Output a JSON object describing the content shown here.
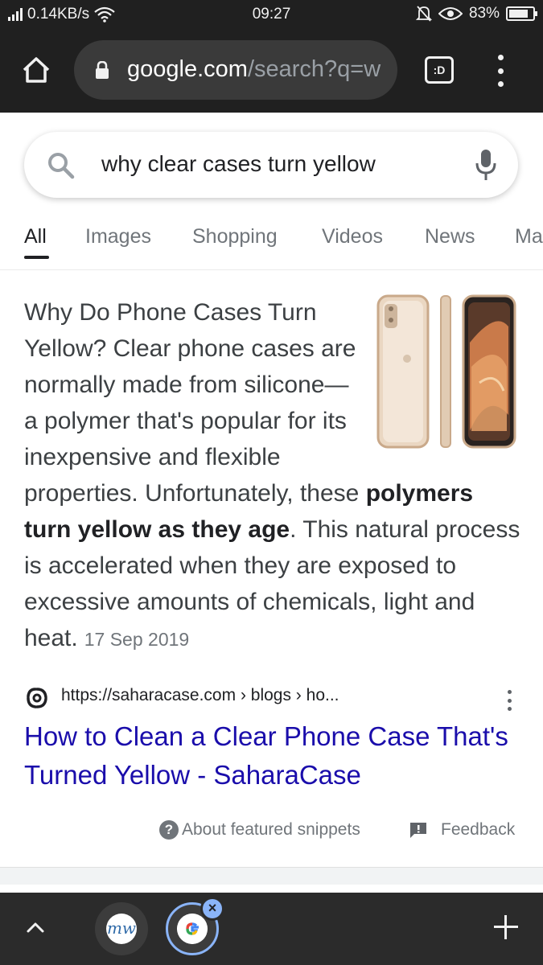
{
  "status_bar": {
    "network_speed": "0.14KB/s",
    "time": "09:27",
    "battery_percent": "83%",
    "battery_level": 0.83
  },
  "browser": {
    "url_domain": "google.com",
    "url_path": "/search?q=w",
    "tab_switcher_label": ":D"
  },
  "search": {
    "query": "why clear cases turn yellow"
  },
  "tabs": [
    "All",
    "Images",
    "Shopping",
    "Videos",
    "News",
    "Ma"
  ],
  "snippet": {
    "text_before": "Why Do Phone Cases Turn Yellow? Clear phone cases are normally made from silicone—a polymer that's popular for its inexpensive and flexible properties. Unfortunately, these ",
    "text_bold": "polymers turn yellow as they age",
    "text_after": ". This natural process is accelerated when they are exposed to excessive amounts of chemicals, light and heat.",
    "date": "17 Sep 2019"
  },
  "source": {
    "url": "https://saharacase.com › blogs › ho...",
    "title": "How to Clean a Clear Phone Case That's Turned Yellow - SaharaCase"
  },
  "footer": {
    "about_label": "About featured snippets",
    "feedback_label": "Feedback"
  },
  "bottom_bar": {
    "tab1_label": "mw"
  },
  "colors": {
    "link": "#1a0dab",
    "toolbar": "#202020",
    "active_tab_ring": "#8ab4f8"
  }
}
